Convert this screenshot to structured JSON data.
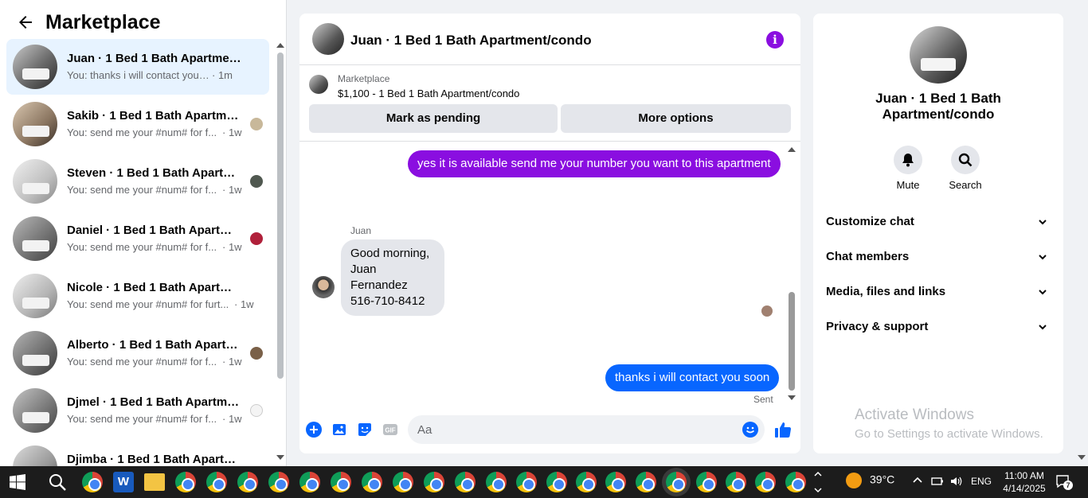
{
  "sidebar": {
    "title": "Marketplace",
    "conversations": [
      {
        "name": "Juan · 1 Bed 1 Bath Apartment/c...",
        "snippet": "You: thanks i will contact you soon",
        "time": "· 1m",
        "active": true
      },
      {
        "name": "Sakib · 1 Bed 1 Bath Apartmen...",
        "snippet": "You: send me your #num# for f...",
        "time": "· 1w"
      },
      {
        "name": "Steven · 1 Bed 1 Bath Apartme...",
        "snippet": "You: send me your #num# for f...",
        "time": "· 1w"
      },
      {
        "name": "Daniel · 1 Bed 1 Bath Apartme...",
        "snippet": "You: send me your #num# for f...",
        "time": "· 1w"
      },
      {
        "name": "Nicole · 1 Bed 1 Bath Apartment/...",
        "snippet": "You: send me your #num# for furt...",
        "time": "· 1w"
      },
      {
        "name": "Alberto · 1 Bed 1 Bath Apartm...",
        "snippet": "You: send me your #num# for f...",
        "time": "· 1w"
      },
      {
        "name": "Djmel · 1 Bed 1 Bath Apartme...",
        "snippet": "You: send me your #num# for f...",
        "time": "· 1w"
      },
      {
        "name": "Djimba · 1 Bed 1 Bath Apartment...",
        "snippet": "",
        "time": ""
      }
    ]
  },
  "chat": {
    "title": "Juan · 1 Bed 1 Bath Apartment/condo",
    "marketplace_label": "Marketplace",
    "listing": "$1,100 - 1 Bed 1 Bath Apartment/condo",
    "mark_pending": "Mark as pending",
    "more_options": "More options",
    "msg_out_1": "yes it is available send me your number you want to this apartment",
    "incoming_sender": "Juan",
    "incoming_line_1": "Good morning,",
    "incoming_line_2": "Juan Fernandez",
    "incoming_line_3": "516-710-8412",
    "msg_out_2": "thanks i will contact you soon",
    "sent_label": "Sent",
    "composer_placeholder": "Aa"
  },
  "info": {
    "name": "Juan · 1 Bed 1 Bath Apartment/condo",
    "mute_label": "Mute",
    "search_label": "Search",
    "sections": [
      "Customize chat",
      "Chat members",
      "Media, files and links",
      "Privacy & support"
    ],
    "watermark_1": "Activate Windows",
    "watermark_2": "Go to Settings to activate Windows."
  },
  "taskbar": {
    "temperature": "39°C",
    "language": "ENG",
    "time": "11:00 AM",
    "date": "4/14/2025",
    "notifications": "7"
  },
  "colors": {
    "accent_purple": "#8a0ee0",
    "accent_blue": "#0866ff",
    "active_conversation": "#e7f3ff"
  }
}
